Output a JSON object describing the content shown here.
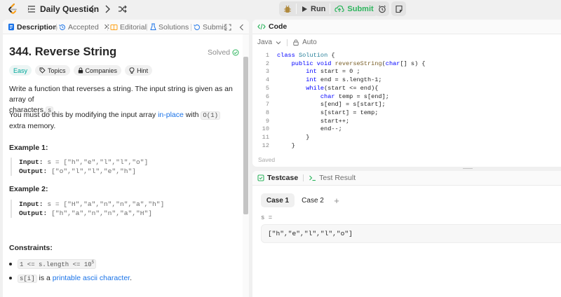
{
  "nav": {
    "daily_label": "Daily Question",
    "run_label": "Run",
    "submit_label": "Submit",
    "accent": "#ffa116",
    "submit_color": "#2db55d"
  },
  "left_tabs": [
    {
      "label": "Description",
      "icon": "description-icon",
      "active": true
    },
    {
      "label": "Accepted",
      "icon": "history-icon",
      "active": false
    },
    {
      "label": "Editorial",
      "icon": "book-icon",
      "active": false
    },
    {
      "label": "Solutions",
      "icon": "flask-icon",
      "active": false
    },
    {
      "label": "Submis",
      "icon": "history-icon",
      "active": false
    }
  ],
  "problem": {
    "title": "344. Reverse String",
    "status": "Solved",
    "chips": [
      "Easy",
      "Topics",
      "Companies",
      "Hint"
    ],
    "desc_line1": "Write a function that reverses a string. The input string is given as an array of",
    "desc_line2_pre": "characters",
    "desc_line2_code": "s",
    "desc_line2_post": ".",
    "desc2_pre": "You must do this by modifying the input array",
    "desc2_link": "in-place",
    "desc2_mid": "with",
    "desc2_code": "O(1)",
    "desc2_post": "extra memory.",
    "examples": [
      {
        "heading": "Example 1:",
        "input_label": "Input:",
        "input": "s = [\"h\",\"e\",\"l\",\"l\",\"o\"]",
        "output_label": "Output:",
        "output": "[\"o\",\"l\",\"l\",\"e\",\"h\"]"
      },
      {
        "heading": "Example 2:",
        "input_label": "Input:",
        "input": "s = [\"H\",\"a\",\"n\",\"n\",\"a\",\"h\"]",
        "output_label": "Output:",
        "output": "[\"h\",\"a\",\"n\",\"n\",\"a\",\"H\"]"
      }
    ],
    "constraints_heading": "Constraints:",
    "constraint1_code": "1 <= s.length <= 10",
    "constraint1_sup": "5",
    "constraint2_code": "s[i]",
    "constraint2_mid": "is a",
    "constraint2_link": "printable ascii character",
    "constraint2_post": "."
  },
  "code": {
    "header": "Code",
    "language": "Java",
    "mode": "Auto",
    "line_numbers": [
      "1",
      "2",
      "3",
      "4",
      "5",
      "6",
      "7",
      "8",
      "9",
      "10",
      "11",
      "12"
    ],
    "saved_label": "Saved"
  },
  "test": {
    "tab_testcase": "Testcase",
    "tab_result": "Test Result",
    "case1": "Case 1",
    "case2": "Case 2",
    "add": "+",
    "param_label": "s =",
    "param_value": "[\"h\",\"e\",\"l\",\"l\",\"o\"]"
  }
}
